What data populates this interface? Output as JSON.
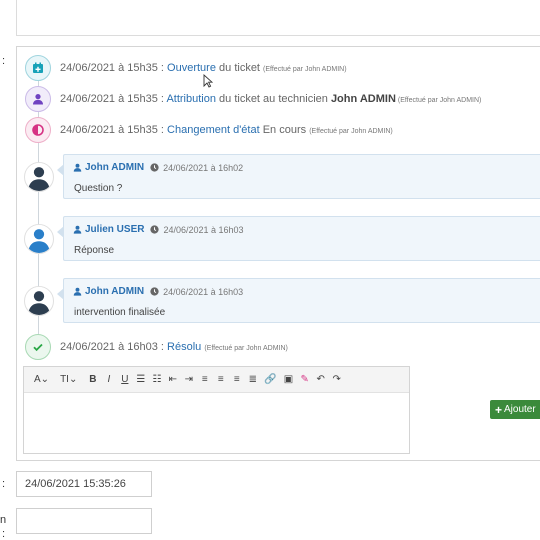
{
  "labels": {
    "colon_1": ":",
    "colon_2": ":",
    "frag_n": "n",
    "frag_colon": ":"
  },
  "timeline": {
    "events": [
      {
        "date": "24/06/2021 à 15h35 : ",
        "action": "Ouverture",
        "rest": " du ticket ",
        "by": "(Effectué par John ADMIN)",
        "icon": "calendar-plus-icon",
        "color": "#17a2b8"
      },
      {
        "date": "24/06/2021 à 15h35 : ",
        "action": "Attribution",
        "rest": " du ticket au technicien ",
        "tech": "John ADMIN",
        "by": " (Effectué par John ADMIN)",
        "icon": "user-icon",
        "color": "#6f42c1"
      },
      {
        "date": "24/06/2021 à 15h35 : ",
        "action": "Changement d'état",
        "rest": " En cours ",
        "by": "(Effectué par John ADMIN)",
        "icon": "half-circle-icon",
        "color": "#d63384"
      },
      {
        "date": "24/06/2021 à 16h03 : ",
        "action": "Résolu",
        "rest": " ",
        "by": "(Effectué par John ADMIN)",
        "icon": "check-icon",
        "color": "#28a745"
      }
    ],
    "messages": [
      {
        "author": "John ADMIN",
        "date": "24/06/2021 à 16h02",
        "body": "Question ?",
        "avatar_color": "#2d3e50"
      },
      {
        "author": "Julien USER",
        "date": "24/06/2021 à 16h03",
        "body": "Réponse",
        "avatar_color": "#2a7fc9"
      },
      {
        "author": "John ADMIN",
        "date": "24/06/2021 à 16h03",
        "body": "intervention finalisée",
        "avatar_color": "#2d3e50"
      }
    ]
  },
  "editor": {
    "toolbar": [
      {
        "name": "font-color-button",
        "label": "A⌄"
      },
      {
        "name": "font-size-button",
        "label": "TI⌄"
      },
      {
        "name": "bold-button",
        "label": "B"
      },
      {
        "name": "italic-button",
        "label": "I"
      },
      {
        "name": "underline-button",
        "label": "U"
      },
      {
        "name": "bullet-list-button",
        "label": "☰"
      },
      {
        "name": "numbered-list-button",
        "label": "☷"
      },
      {
        "name": "outdent-button",
        "label": "⇤"
      },
      {
        "name": "indent-button",
        "label": "⇥"
      },
      {
        "name": "align-left-button",
        "label": "≡"
      },
      {
        "name": "align-center-button",
        "label": "≡"
      },
      {
        "name": "align-right-button",
        "label": "≡"
      },
      {
        "name": "justify-button",
        "label": "≣"
      },
      {
        "name": "link-button",
        "label": "🔗"
      },
      {
        "name": "image-button",
        "label": "▣"
      },
      {
        "name": "clear-format-button",
        "label": "✎"
      },
      {
        "name": "undo-button",
        "label": "↶"
      },
      {
        "name": "redo-button",
        "label": "↷"
      }
    ]
  },
  "add_button": {
    "label": "Ajouter",
    "icon": "plus-icon"
  },
  "date_field": {
    "value": "24/06/2021 15:35:26"
  },
  "empty_field": {
    "value": ""
  }
}
